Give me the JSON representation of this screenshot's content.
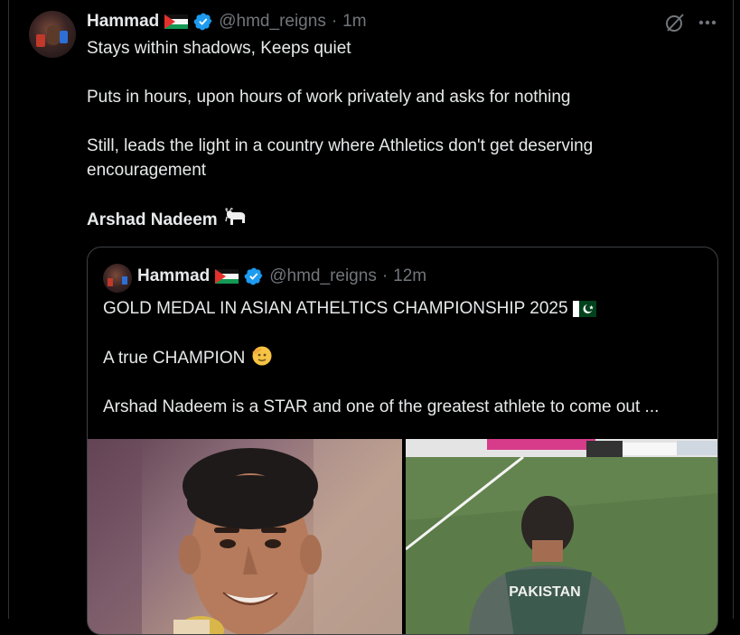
{
  "tweet": {
    "name": "Hammad",
    "handle": "@hmd_reigns",
    "separator": "·",
    "time": "1m",
    "lines": [
      "Stays within shadows, Keeps quiet",
      "Puts in hours, upon hours of work privately and asks for nothing",
      "Still, leads the light in a country where Athletics don't get deserving encouragement"
    ],
    "signature": "Arshad Nadeem",
    "signature_emoji": "goat"
  },
  "quote": {
    "name": "Hammad",
    "handle": "@hmd_reigns",
    "separator": "·",
    "time": "12m",
    "lines": [
      "GOLD MEDAL IN ASIAN ATHELTICS CHAMPIONSHIP 2025",
      "A true CHAMPION",
      "Arshad Nadeem is a STAR and one of the greatest athlete to come out ..."
    ],
    "line1_emoji": "pakistan-flag",
    "line2_emoji": "saluting-face",
    "media": [
      {
        "description": "athlete-smiling-with-medal",
        "jersey_text": ""
      },
      {
        "description": "athlete-back-on-field",
        "jersey_text": "PAKISTAN"
      }
    ]
  },
  "icons": {
    "verified": "verified-badge-icon",
    "grok": "grok-icon",
    "more": "more-icon",
    "flag": "palestine-flag-icon"
  },
  "colors": {
    "background": "#000000",
    "text": "#e7e9ea",
    "secondary": "#71767b",
    "verified": "#1d9bf0",
    "border": "#2f3336"
  }
}
